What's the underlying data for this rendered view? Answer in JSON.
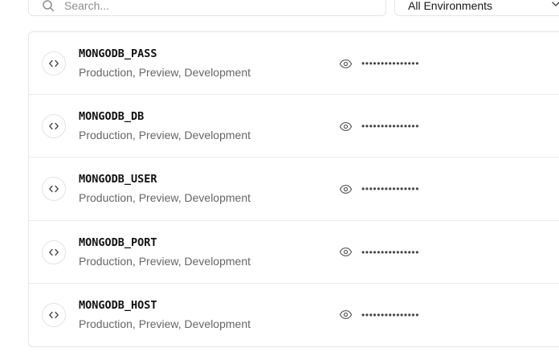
{
  "filters": {
    "search_placeholder": "Search...",
    "environment_selected": "All Environments"
  },
  "variables": [
    {
      "name": "MONGODB_PASS",
      "environments": "Production, Preview, Development",
      "masked": "•••••••••••••••"
    },
    {
      "name": "MONGODB_DB",
      "environments": "Production, Preview, Development",
      "masked": "•••••••••••••••"
    },
    {
      "name": "MONGODB_USER",
      "environments": "Production, Preview, Development",
      "masked": "•••••••••••••••"
    },
    {
      "name": "MONGODB_PORT",
      "environments": "Production, Preview, Development",
      "masked": "•••••••••••••••"
    },
    {
      "name": "MONGODB_HOST",
      "environments": "Production, Preview, Development",
      "masked": "•••••••••••••••"
    }
  ],
  "icons": {
    "search": "search-icon",
    "select": "chevron-down-icon",
    "variable": "code-icon",
    "reveal": "eye-icon"
  },
  "colors": {
    "border": "#e5e5e5",
    "text_primary": "#111111",
    "text_secondary": "#666666"
  }
}
